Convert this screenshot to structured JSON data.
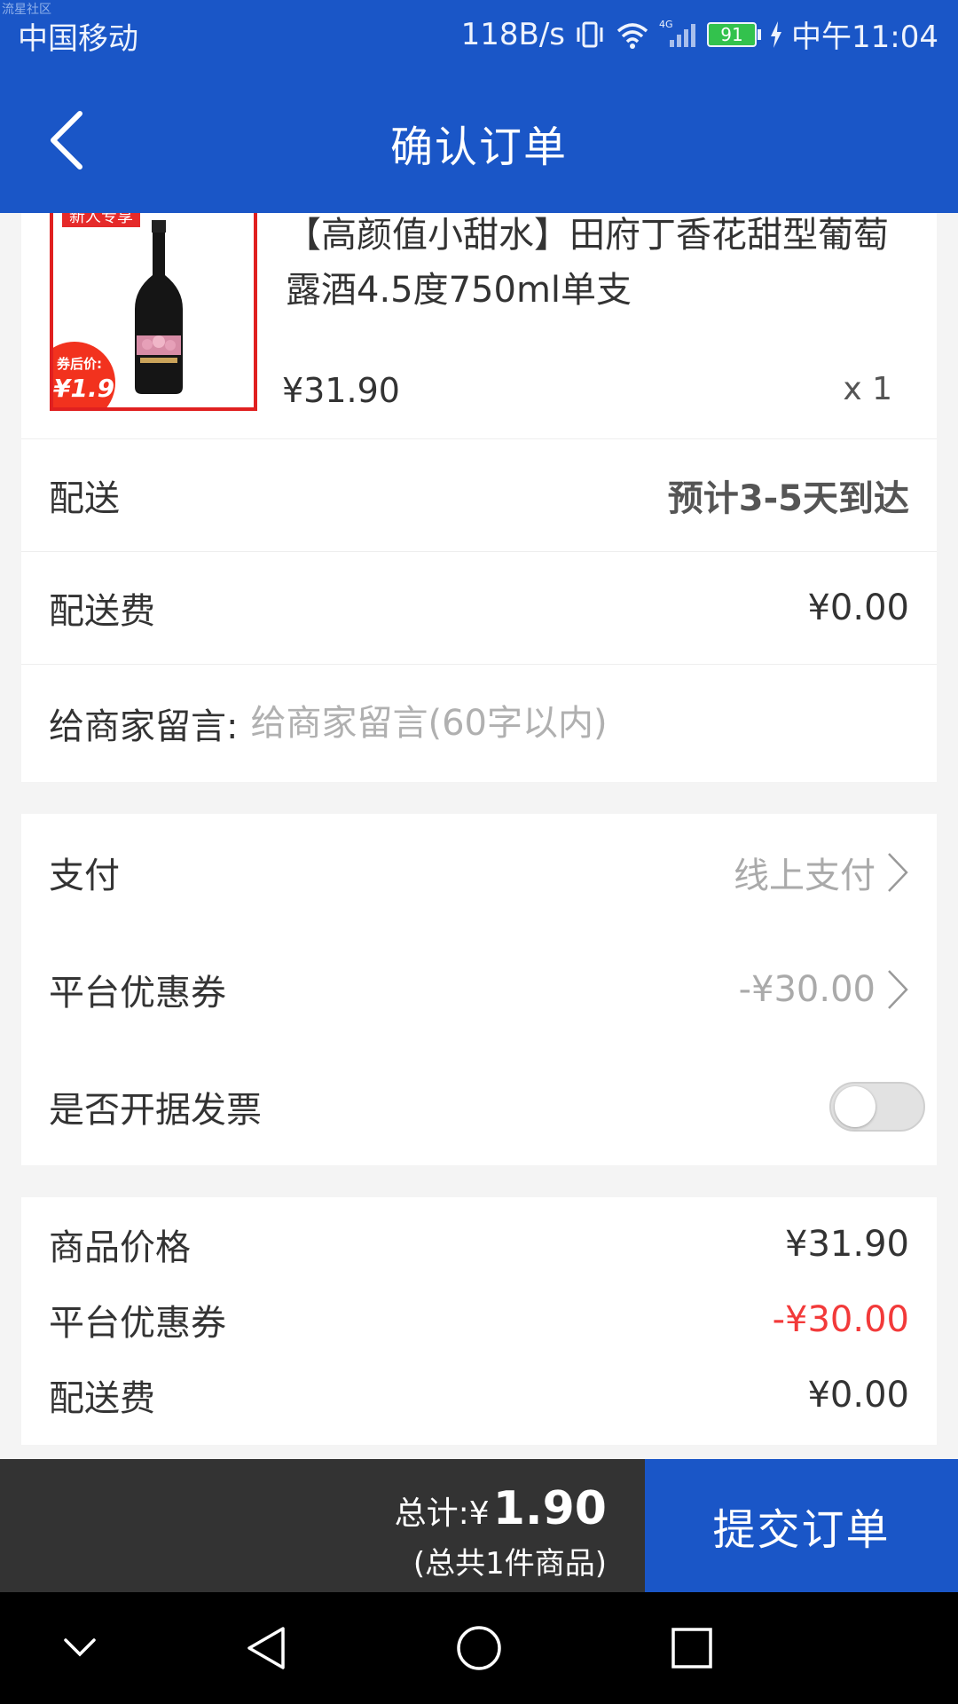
{
  "status_bar": {
    "watermark": "流星社区",
    "carrier": "中国移动",
    "network_speed": "118B/s",
    "network_type": "4G",
    "battery_level": "91",
    "time": "中午11:04",
    "icons": [
      "vibrate-icon",
      "wifi-icon",
      "signal-icon",
      "battery-icon",
      "charging-icon"
    ]
  },
  "header": {
    "title": "确认订单",
    "back_icon": "chevron-left-icon"
  },
  "product": {
    "image_tag": "新人专享",
    "coupon_badge_label": "券后价:",
    "coupon_badge_value": "¥1.9",
    "title": "【高颜值小甜水】田府丁香花甜型葡萄露酒4.5度750ml单支",
    "price": "¥31.90",
    "quantity": "x 1"
  },
  "delivery": {
    "label": "配送",
    "value": "预计3-5天到达"
  },
  "delivery_fee": {
    "label": "配送费",
    "value": "¥0.00"
  },
  "message": {
    "label": "给商家留言:",
    "placeholder": "给商家留言(60字以内)"
  },
  "payment": {
    "label": "支付",
    "value": "线上支付"
  },
  "coupon": {
    "label": "平台优惠券",
    "value": "-¥30.00"
  },
  "invoice": {
    "label": "是否开据发票",
    "enabled": false
  },
  "summary": {
    "items": [
      {
        "label": "商品价格",
        "value": "¥31.90"
      },
      {
        "label": "平台优惠券",
        "value": "-¥30.00"
      },
      {
        "label": "配送费",
        "value": "¥0.00"
      }
    ]
  },
  "footer": {
    "total_label": "总计:¥",
    "total_amount": "1.90",
    "total_count": "(总共1件商品)",
    "submit_label": "提交订单"
  },
  "nav": {
    "icons": [
      "chevron-down-icon",
      "back-triangle-icon",
      "home-circle-icon",
      "recents-square-icon"
    ]
  },
  "colors": {
    "primary": "#1a56c7",
    "discount_red": "#f23a3a",
    "footer_bg": "#333333"
  }
}
